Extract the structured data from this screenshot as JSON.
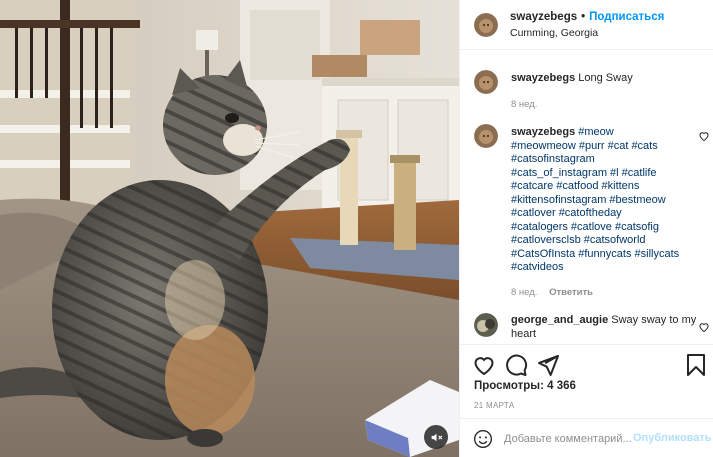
{
  "post": {
    "username": "swayzebegs",
    "separator": "•",
    "follow_label": "Подписаться",
    "location": "Cumming, Georgia"
  },
  "comments": [
    {
      "username": "swayzebegs",
      "text": "Long Sway",
      "time": "8 нед.",
      "reply_label": ""
    },
    {
      "username": "swayzebegs",
      "text": "#meow\n#meowmeow #purr #cat #cats\n#catsofinstagram\n#cats_of_instagram #l #catlife\n#catcare #catfood #kittens\n#kittensofinstagram #bestmeow\n#catlover #catoftheday\n#catalogers #catlove #catsofig\n#catloversclsb #catsofworld\n#CatsOfInsta #funnycats #sillycats\n#catvideos",
      "time": "8 нед.",
      "reply_label": "Ответить"
    },
    {
      "username": "george_and_augie",
      "text": "Sway sway to my heart"
    }
  ],
  "actions": {
    "views_label": "Просмотры: 4 366",
    "date": "21 МАРТА"
  },
  "add_comment": {
    "placeholder": "Добавьте комментарий...",
    "post_label": "Опубликовать"
  },
  "icons": [
    "volume-mute-icon",
    "heart-icon",
    "comment-icon",
    "share-icon",
    "bookmark-icon",
    "emoji-icon"
  ],
  "colors": {
    "link": "#0095f6",
    "hashtag": "#00376b",
    "muted": "#8e8e8e",
    "post_disabled": "#b2dffc"
  }
}
